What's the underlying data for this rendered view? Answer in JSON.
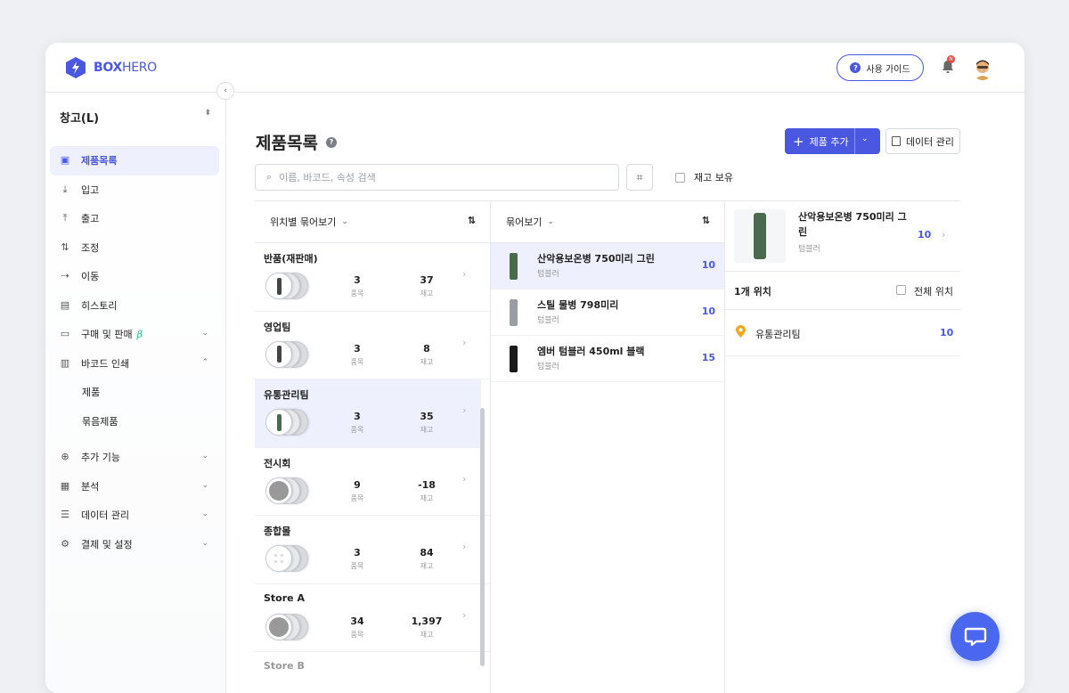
{
  "brand": {
    "name_part1": "BOX",
    "name_part2": "HERO"
  },
  "header": {
    "guide_label": "사용 가이드",
    "notification_count": "N"
  },
  "sidebar": {
    "warehouse": "창고(L)",
    "items": [
      {
        "label": "제품목록",
        "icon": "box-icon",
        "active": true
      },
      {
        "label": "입고",
        "icon": "arrow-down-icon"
      },
      {
        "label": "출고",
        "icon": "arrow-up-icon"
      },
      {
        "label": "조정",
        "icon": "arrows-updown-icon"
      },
      {
        "label": "이동",
        "icon": "arrow-right-icon"
      },
      {
        "label": "히스토리",
        "icon": "history-icon"
      },
      {
        "label": "구매 및 판매",
        "icon": "document-icon",
        "beta": "β"
      },
      {
        "label": "바코드 인쇄",
        "icon": "barcode-icon"
      }
    ],
    "subitems": [
      "제품",
      "묶음제품"
    ],
    "more_items": [
      {
        "label": "추가 기능",
        "icon": "plus-circle-icon"
      },
      {
        "label": "분석",
        "icon": "chart-icon"
      },
      {
        "label": "데이터 관리",
        "icon": "database-icon"
      },
      {
        "label": "결제 및 설정",
        "icon": "gear-icon"
      }
    ]
  },
  "main": {
    "title": "제품목록",
    "add_button": "제품 추가",
    "data_button": "데이터 관리",
    "search_placeholder": "이름, 바코드, 속성 검색",
    "stock_filter": "재고 보유"
  },
  "locations_panel": {
    "header": "위치별 묶어보기",
    "count_label": "품목",
    "stock_label": "재고",
    "rows": [
      {
        "name": "반품(재판매)",
        "items": "3",
        "stock": "37",
        "thumb": "bottle"
      },
      {
        "name": "영업팀",
        "items": "3",
        "stock": "8",
        "thumb": "bottle"
      },
      {
        "name": "유통관리팀",
        "items": "3",
        "stock": "35",
        "thumb": "green",
        "selected": true
      },
      {
        "name": "전시회",
        "items": "9",
        "stock": "-18",
        "thumb": "face"
      },
      {
        "name": "종합몰",
        "items": "3",
        "stock": "84",
        "thumb": "dots"
      },
      {
        "name": "Store A",
        "items": "34",
        "stock": "1,397",
        "thumb": "face"
      },
      {
        "name": "Store B",
        "items": "",
        "stock": "",
        "thumb": "none"
      }
    ]
  },
  "products_panel": {
    "header": "묶어보기",
    "rows": [
      {
        "name": "산악용보온병 750미리 그린",
        "category": "텀블러",
        "qty": "10",
        "color": "#4a6a4d",
        "selected": true
      },
      {
        "name": "스틸 물병 798미리",
        "category": "텀블러",
        "qty": "10",
        "color": "#9a9da2"
      },
      {
        "name": "엠버 텀블러 450ml 블랙",
        "category": "텀블러",
        "qty": "15",
        "color": "#1a1a1a"
      }
    ]
  },
  "detail_panel": {
    "name": "산악용보온병 750미리 그린",
    "category": "텀블러",
    "qty": "10",
    "location_count": "1개 위치",
    "all_locations": "전체 위치",
    "locations": [
      {
        "name": "유통관리팀",
        "qty": "10"
      }
    ]
  },
  "colors": {
    "accent": "#4a57e0",
    "selected_bg": "#eef0fd",
    "pin": "#f5a623"
  }
}
